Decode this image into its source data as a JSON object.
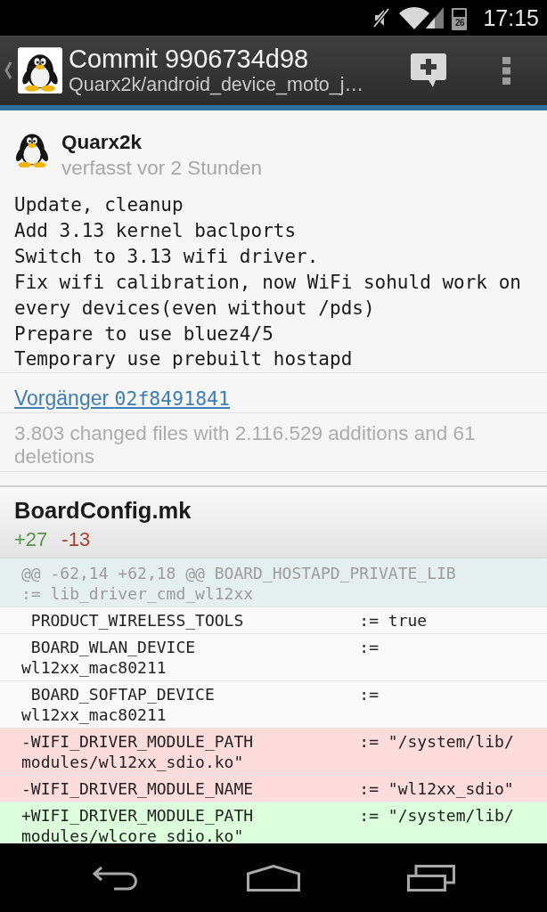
{
  "status_bar": {
    "battery": "26",
    "time": "17:15"
  },
  "action_bar": {
    "title": "Commit 9906734d98",
    "subtitle": "Quarx2k/android_device_moto_j…"
  },
  "commit": {
    "author": "Quarx2k",
    "time": "verfasst vor 2 Stunden",
    "message": "Update, cleanup\nAdd 3.13 kernel baclports\nSwitch to 3.13 wifi driver.\nFix wifi calibration, now WiFi sohuld work on every devices(even without /pds)\nPrepare to use bluez4/5\nTemporary use prebuilt hostapd",
    "parent": {
      "label": "Vorgänger",
      "sha": "02f8491841"
    },
    "stats": "3.803 changed files with 2.116.529 additions and 61 deletions"
  },
  "files": [
    {
      "name": "BoardConfig.mk",
      "additions": "+27",
      "deletions": "-13",
      "diff": [
        {
          "kind": "hunk",
          "text": "@@ -62,14 +62,18 @@ BOARD_HOSTAPD_PRIVATE_LIB         := lib_driver_cmd_wl12xx"
        },
        {
          "kind": "context",
          "text": " PRODUCT_WIRELESS_TOOLS            := true"
        },
        {
          "kind": "context",
          "text": " BOARD_WLAN_DEVICE                 := wl12xx_mac80211"
        },
        {
          "kind": "context",
          "text": " BOARD_SOFTAP_DEVICE               := wl12xx_mac80211"
        },
        {
          "kind": "removed",
          "text": "-WIFI_DRIVER_MODULE_PATH           := \"/system/lib/modules/wl12xx_sdio.ko\""
        },
        {
          "kind": "removed",
          "text": "-WIFI_DRIVER_MODULE_NAME           := \"wl12xx_sdio\""
        },
        {
          "kind": "added",
          "text": "+WIFI_DRIVER_MODULE_PATH           := \"/system/lib/modules/wlcore_sdio.ko\""
        }
      ]
    }
  ]
}
